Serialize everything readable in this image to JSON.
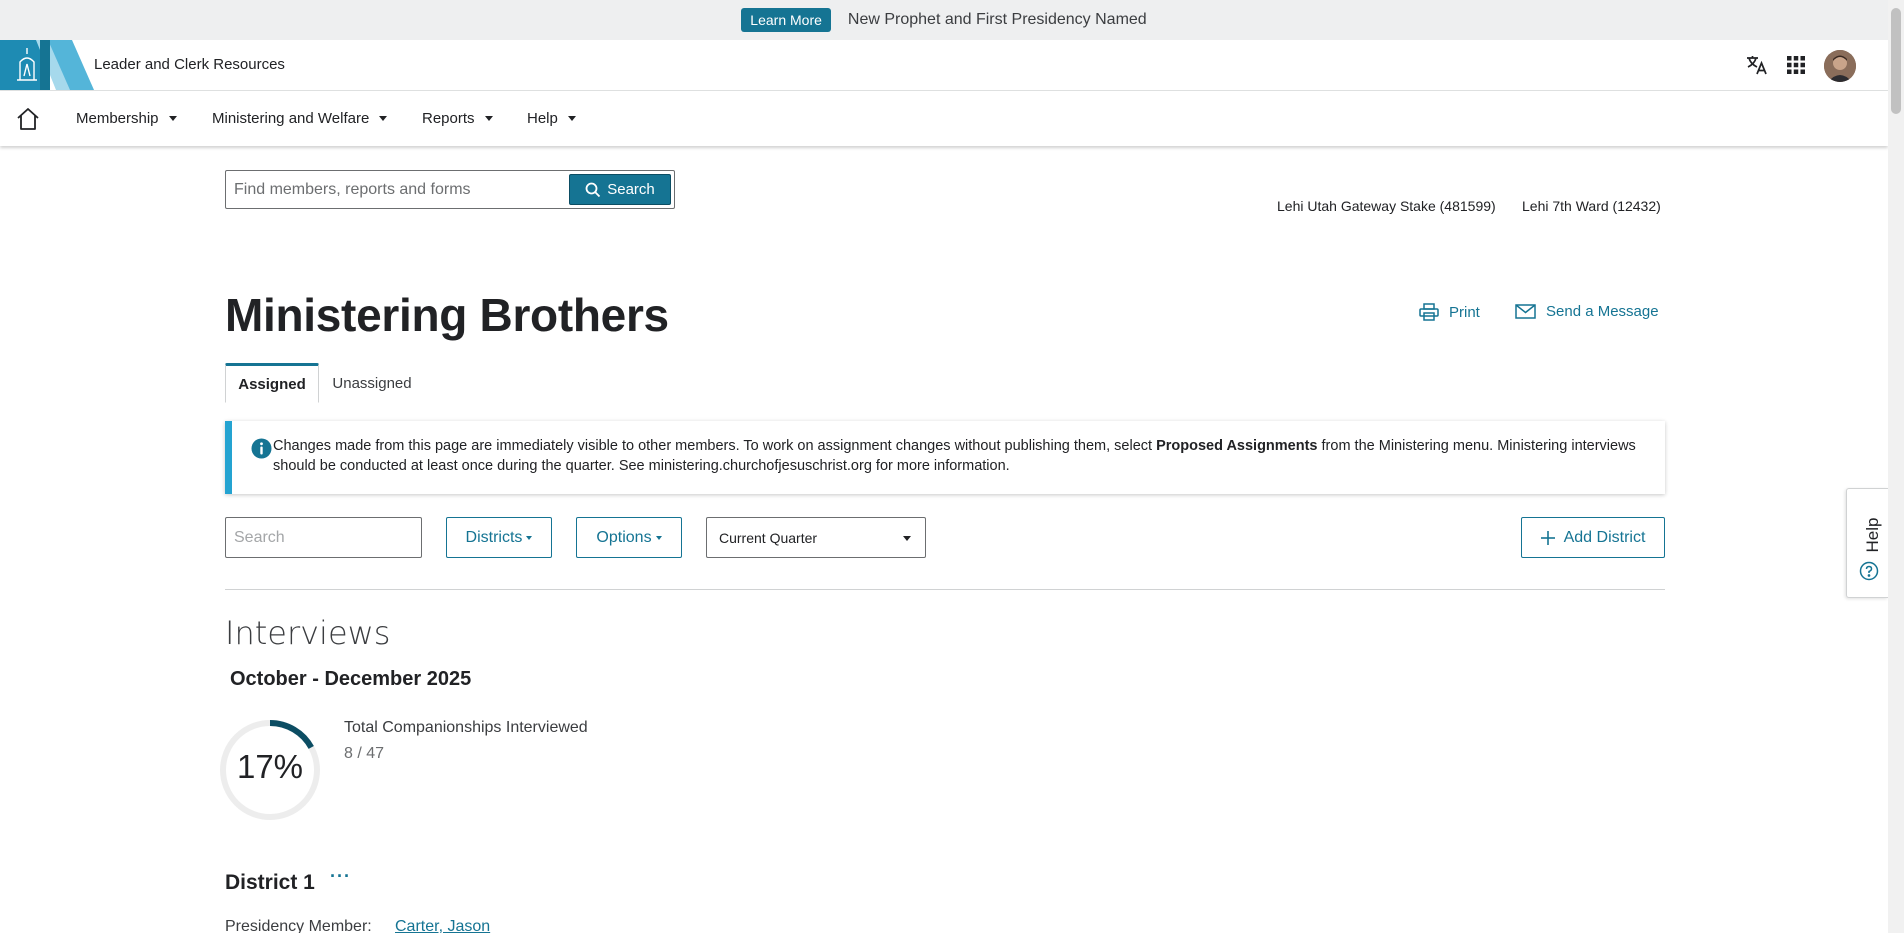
{
  "announcement": {
    "button_label": "Learn More",
    "headline": "New Prophet and First Presidency Named"
  },
  "header": {
    "site_title": "Leader and Clerk Resources",
    "icons": [
      "translate-icon",
      "apps-grid-icon",
      "avatar"
    ]
  },
  "nav": {
    "items": [
      {
        "label": "Membership"
      },
      {
        "label": "Ministering and Welfare"
      },
      {
        "label": "Reports"
      },
      {
        "label": "Help"
      }
    ]
  },
  "search": {
    "placeholder": "Find members, reports and forms",
    "button_label": "Search"
  },
  "units": {
    "stake": "Lehi Utah Gateway Stake (481599)",
    "ward": "Lehi 7th Ward (12432)"
  },
  "page": {
    "title": "Ministering Brothers",
    "print_label": "Print",
    "message_label": "Send a Message"
  },
  "tabs": [
    {
      "label": "Assigned",
      "active": true
    },
    {
      "label": "Unassigned",
      "active": false
    }
  ],
  "info": {
    "text_before": "Changes made from this page are immediately visible to other members. To work on assignment changes without publishing them, select ",
    "bold": "Proposed Assignments",
    "text_after": " from the Ministering menu. Ministering interviews should be conducted at least once during the quarter. See ministering.churchofjesuschrist.org for more information."
  },
  "filters": {
    "search_placeholder": "Search",
    "districts_label": "Districts",
    "options_label": "Options",
    "period_selected": "Current Quarter",
    "add_district_label": "Add District"
  },
  "interviews": {
    "heading": "Interviews",
    "quarter": "October - December 2025",
    "percent": "17%",
    "percent_value": 0.17,
    "label": "Total Companionships Interviewed",
    "count": "8 / 47"
  },
  "district": {
    "name": "District 1",
    "menu": "···",
    "presidency_label": "Presidency Member:",
    "presidency_member": "Carter, Jason"
  },
  "help_tab": {
    "label": "Help"
  },
  "colors": {
    "accent": "#157493",
    "info_border": "#24a3d1"
  }
}
